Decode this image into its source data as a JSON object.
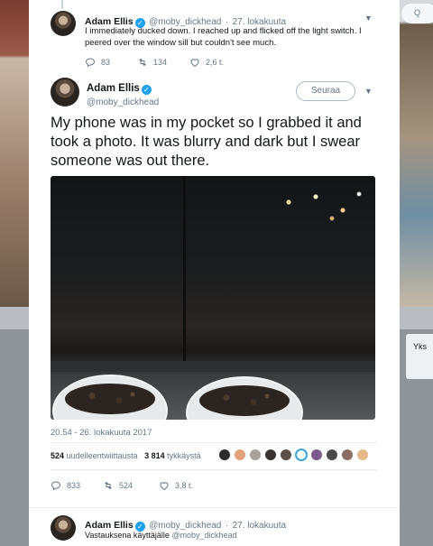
{
  "background": {
    "search_hint": "Q",
    "side_card_text": "Yks"
  },
  "previous_tweet": {
    "name": "Adam Ellis",
    "handle": "@moby_dickhead",
    "time": "27. lokakuuta",
    "text": "I immediately ducked down. I reached up and flicked off the light switch. I peered over the window sill but couldn't see much.",
    "replies": "83",
    "retweets": "134",
    "likes": "2,6 t."
  },
  "main_tweet": {
    "name": "Adam Ellis",
    "handle": "@moby_dickhead",
    "follow_label": "Seuraa",
    "text": "My phone was in my pocket so I grabbed it and took a photo. It was blurry and dark but I swear someone was out there.",
    "timestamp": "20.54 - 26. lokakuuta 2017",
    "retweet_count": "524",
    "retweet_label": "uudelleentwiittausta",
    "like_count": "3 814",
    "like_label": "tykkäystä",
    "replies": "833",
    "retweets": "524",
    "likes": "3,8 t."
  },
  "reply_tweet": {
    "name": "Adam Ellis",
    "handle": "@moby_dickhead",
    "time": "27. lokakuuta",
    "reply_prefix": "Vastauksena käyttäjälle",
    "reply_handle": "@moby_dickhead"
  },
  "colors": {
    "accent": "#1da1f2",
    "muted": "#657786",
    "text": "#14171a"
  },
  "icons": [
    "reply-icon",
    "retweet-icon",
    "like-icon",
    "verified-icon",
    "chevron-down-icon"
  ]
}
